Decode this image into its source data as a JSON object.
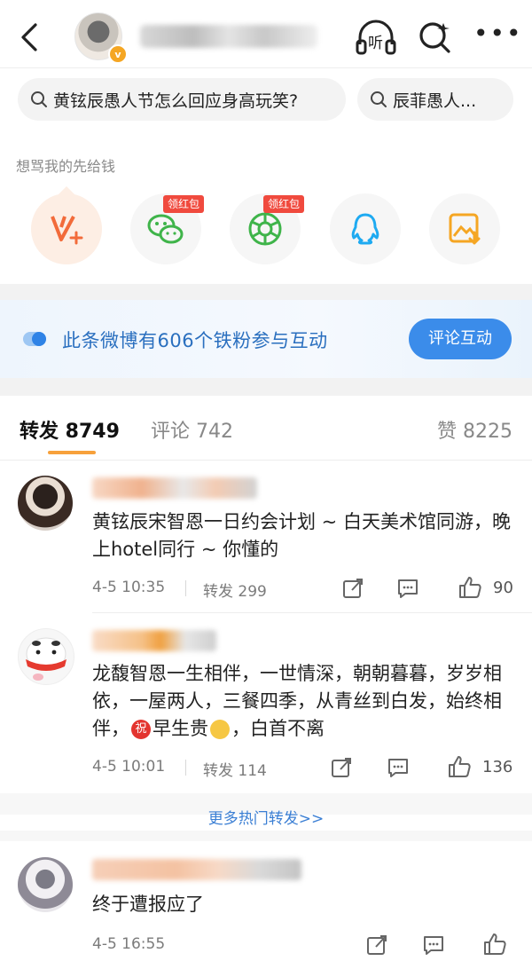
{
  "header": {
    "back_icon": "back-chevron-icon",
    "listen_label": "听",
    "more_label": "•••"
  },
  "search_chips": [
    {
      "text": "黄铉辰愚人节怎么回应身高玩笑?"
    },
    {
      "text": "辰菲愚人..."
    }
  ],
  "share": {
    "caption": "想骂我的先给钱",
    "buttons": [
      {
        "icon": "vplus-icon",
        "tag": ""
      },
      {
        "icon": "wechat-icon",
        "tag": "领红包"
      },
      {
        "icon": "moments-icon",
        "tag": "领红包"
      },
      {
        "icon": "qq-icon",
        "tag": ""
      },
      {
        "icon": "save-image-icon",
        "tag": ""
      }
    ]
  },
  "banner": {
    "text": "此条微博有606个铁粉参与互动",
    "button": "评论互动"
  },
  "tabs": {
    "reposts": "转发 8749",
    "comments": "评论 742",
    "likes": "赞 8225"
  },
  "posts": [
    {
      "text": "黄铉辰宋智恩一日约会计划 ~ 白天美术馆同游，晚上hotel同行 ~ 你懂的",
      "time": "4-5 10:35",
      "repost": "转发 299",
      "likes": "90"
    },
    {
      "text_a": "龙馥智恩一生相伴，一世情深，朝朝暮暮，岁岁相依，一屋两人，三餐四季，从青丝到白发，始终相伴，",
      "emoji_1": "祝",
      "text_b": "早生贵",
      "text_c": "，白首不离",
      "time": "4-5 10:01",
      "repost": "转发 114",
      "likes": "136"
    },
    {
      "text": "终于遭报应了",
      "time": "4-5 16:55",
      "repost": "",
      "likes": ""
    }
  ],
  "more_hot": "更多热门转发>>",
  "colors": {
    "accent_orange": "#f7a13b",
    "link_blue": "#3b8cea",
    "red_tag": "#f04a3e"
  }
}
